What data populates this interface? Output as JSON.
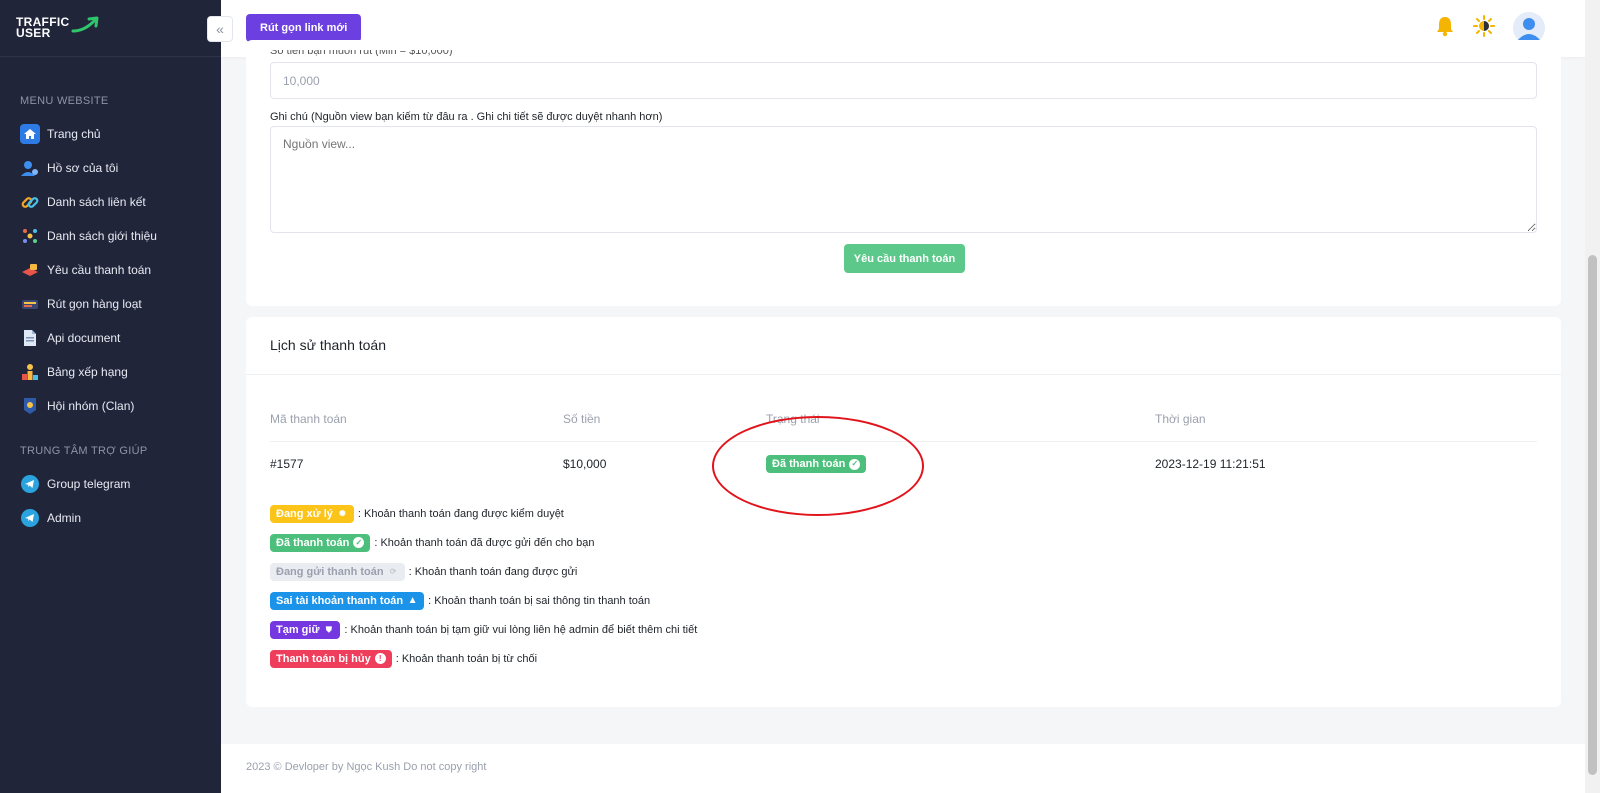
{
  "logo": {
    "line1": "TRAFFIC",
    "line2": "USER"
  },
  "sidebar": {
    "section1": "MENU WEBSITE",
    "items1": [
      {
        "label": "Trang chủ",
        "icon": "home-icon"
      },
      {
        "label": "Hồ sơ của tôi",
        "icon": "profile-icon"
      },
      {
        "label": "Danh sách liên kết",
        "icon": "link-icon"
      },
      {
        "label": "Danh sách giới thiệu",
        "icon": "referral-icon"
      },
      {
        "label": "Yêu cầu thanh toán",
        "icon": "payment-icon"
      },
      {
        "label": "Rút gọn hàng loạt",
        "icon": "bulk-shorten-icon"
      },
      {
        "label": "Api document",
        "icon": "document-icon"
      },
      {
        "label": "Bảng xếp hạng",
        "icon": "trophy-icon"
      },
      {
        "label": "Hội nhóm (Clan)",
        "icon": "clan-icon"
      }
    ],
    "section2": "TRUNG TÂM TRỢ GIÚP",
    "items2": [
      {
        "label": "Group telegram",
        "icon": "telegram-icon"
      },
      {
        "label": "Admin",
        "icon": "telegram-icon"
      }
    ]
  },
  "topbar": {
    "new_link_label": "Rút gọn link mới"
  },
  "form": {
    "amount_value": "10,000",
    "note_label": "Ghi chú (Nguồn view bạn kiếm từ đâu ra . Ghi chi tiết sẽ được duyệt nhanh hơn)",
    "note_placeholder": "Nguồn view...",
    "submit_label": "Yêu cầu thanh toán"
  },
  "history": {
    "title": "Lịch sử thanh toán",
    "headers": [
      "Mã thanh toán",
      "Số tiền",
      "Trạng thái",
      "Thời gian"
    ],
    "rows": [
      {
        "id": "#1577",
        "amount": "$10,000",
        "status": "Đã thanh toán",
        "time": "2023-12-19 11:21:51"
      }
    ]
  },
  "legend": [
    {
      "badge": "Đang xử lý",
      "desc": ": Khoản thanh toán đang được kiểm duyệt"
    },
    {
      "badge": "Đã thanh toán",
      "desc": ": Khoản thanh toán đã được gửi đến cho bạn"
    },
    {
      "badge": "Đang gửi thanh toán",
      "desc": ": Khoản thanh toán đang được gửi"
    },
    {
      "badge": "Sai tài khoản thanh toán",
      "desc": ": Khoản thanh toán bị sai thông tin thanh toán"
    },
    {
      "badge": "Tạm giữ",
      "desc": ": Khoản thanh toán bị tạm giữ vui lòng liên hệ admin để biết thêm chi tiết"
    },
    {
      "badge": "Thanh toán bị hủy",
      "desc": ": Khoản thanh toán bị từ chối"
    }
  ],
  "footer": {
    "text": "2023 © Devloper by Ngọc Kush Do not copy right"
  },
  "colors": {
    "sidebar_bg": "#21253a",
    "primary": "#6b3fe0",
    "success": "#4cbf7d",
    "annotation": "#e1141c"
  }
}
